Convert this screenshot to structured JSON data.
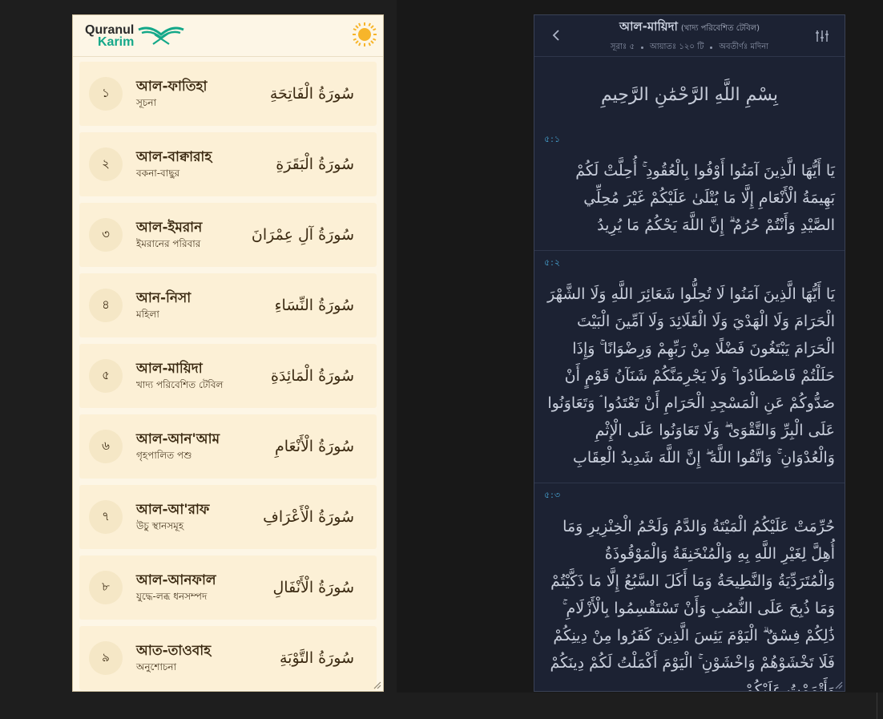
{
  "left": {
    "logo": {
      "line1": "Quranul",
      "line2": "Karim"
    },
    "theme_toggle": "sun-icon",
    "surahs": [
      {
        "num": "১",
        "name": "আল-ফাতিহা",
        "meaning": "সূচনা",
        "arabic": "سُورَةُ الْفَاتِحَةِ"
      },
      {
        "num": "২",
        "name": "আল-বাক্বারাহ",
        "meaning": "বকনা-বাছুর",
        "arabic": "سُورَةُ الْبَقَرَةِ"
      },
      {
        "num": "৩",
        "name": "আল-ইমরান",
        "meaning": "ইমরানের পরিবার",
        "arabic": "سُورَةُ آلِ عِمْرَانَ"
      },
      {
        "num": "৪",
        "name": "আন-নিসা",
        "meaning": "মহিলা",
        "arabic": "سُورَةُ النِّسَاءِ"
      },
      {
        "num": "৫",
        "name": "আল-মায়িদা",
        "meaning": "খাদ্য পরিবেশিত টেবিল",
        "arabic": "سُورَةُ الْمَائِدَةِ"
      },
      {
        "num": "৬",
        "name": "আল-আন'আম",
        "meaning": "গৃহপালিত পশু",
        "arabic": "سُورَةُ الْأَنْعَامِ"
      },
      {
        "num": "৭",
        "name": "আল-আ'রাফ",
        "meaning": "উচু স্থানসমূহ",
        "arabic": "سُورَةُ الْأَعْرَافِ"
      },
      {
        "num": "৮",
        "name": "আল-আনফাল",
        "meaning": "যুদ্ধে-লব্ধ ধনসম্পদ",
        "arabic": "سُورَةُ الْأَنْفَالِ"
      },
      {
        "num": "৯",
        "name": "আত-তাওবাহ",
        "meaning": "অনুশোচনা",
        "arabic": "سُورَةُ التَّوْبَةِ"
      }
    ]
  },
  "right": {
    "title": "আল-মায়িদা",
    "subtitle": "(খাদ্য পরিবেশিত টেবিল)",
    "meta": [
      "সূরাঃ ৫",
      "আয়াতঃ ১২০ টি",
      "অবতীর্ণঃ মদিনা"
    ],
    "bismillah": "بِسْمِ اللَّهِ الرَّحْمَٰنِ الرَّحِيمِ",
    "ayahs": [
      {
        "ref": "৫:১",
        "text": "يَا أَيُّهَا الَّذِينَ آمَنُوا أَوْفُوا بِالْعُقُودِ ۚ أُحِلَّتْ لَكُمْ بَهِيمَةُ الْأَنْعَامِ إِلَّا مَا يُتْلَىٰ عَلَيْكُمْ غَيْرَ مُحِلِّي الصَّيْدِ وَأَنْتُمْ حُرُمٌ ۗ إِنَّ اللَّهَ يَحْكُمُ مَا يُرِيدُ"
      },
      {
        "ref": "৫:২",
        "text": "يَا أَيُّهَا الَّذِينَ آمَنُوا لَا تُحِلُّوا شَعَائِرَ اللَّهِ وَلَا الشَّهْرَ الْحَرَامَ وَلَا الْهَدْيَ وَلَا الْقَلَائِدَ وَلَا آمِّينَ الْبَيْتَ الْحَرَامَ يَبْتَغُونَ فَضْلًا مِنْ رَبِّهِمْ وَرِضْوَانًا ۚ وَإِذَا حَلَلْتُمْ فَاصْطَادُوا ۚ وَلَا يَجْرِمَنَّكُمْ شَنَآنُ قَوْمٍ أَنْ صَدُّوكُمْ عَنِ الْمَسْجِدِ الْحَرَامِ أَنْ تَعْتَدُوا ۘ وَتَعَاوَنُوا عَلَى الْبِرِّ وَالتَّقْوَىٰ ۖ وَلَا تَعَاوَنُوا عَلَى الْإِثْمِ وَالْعُدْوَانِ ۚ وَاتَّقُوا اللَّهَ ۖ إِنَّ اللَّهَ شَدِيدُ الْعِقَابِ"
      },
      {
        "ref": "৫:৩",
        "text": "حُرِّمَتْ عَلَيْكُمُ الْمَيْتَةُ وَالدَّمُ وَلَحْمُ الْخِنْزِيرِ وَمَا أُهِلَّ لِغَيْرِ اللَّهِ بِهِ وَالْمُنْخَنِقَةُ وَالْمَوْقُوذَةُ وَالْمُتَرَدِّيَةُ وَالنَّطِيحَةُ وَمَا أَكَلَ السَّبُعُ إِلَّا مَا ذَكَّيْتُمْ وَمَا ذُبِحَ عَلَى النُّصُبِ وَأَنْ تَسْتَقْسِمُوا بِالْأَزْلَامِ ۚ ذَٰلِكُمْ فِسْقٌ ۗ الْيَوْمَ يَئِسَ الَّذِينَ كَفَرُوا مِنْ دِينِكُمْ فَلَا تَخْشَوْهُمْ وَاخْشَوْنِ ۚ الْيَوْمَ أَكْمَلْتُ لَكُمْ دِينَكُمْ وَأَتْمَمْتُ عَلَيْكُمْ"
      }
    ]
  },
  "colors": {
    "light_bg": "#fdf6e6",
    "card_bg": "#fcf0d6",
    "brand_teal": "#14a889",
    "dark_bg": "#1c2233",
    "ayah_ref": "#48a7d6"
  }
}
